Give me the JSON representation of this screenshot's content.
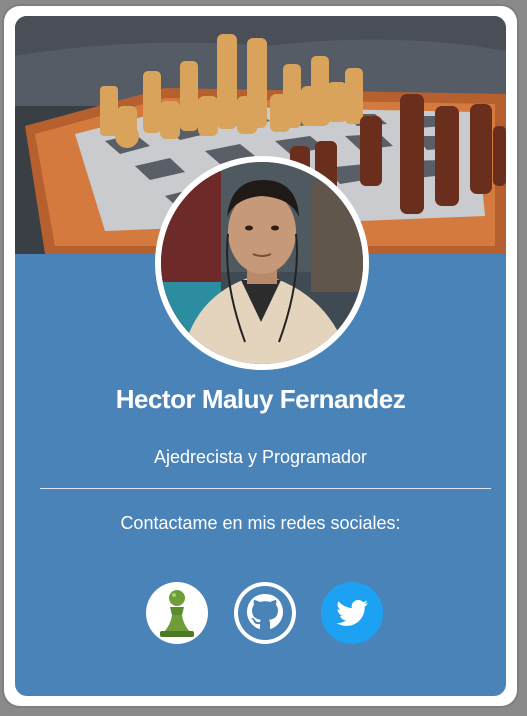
{
  "profile": {
    "name": "Hector Maluy Fernandez",
    "role": "Ajedrecista y Programador",
    "contact_text": "Contactame en mis redes sociales:"
  },
  "social": [
    {
      "icon": "chess-pawn-icon",
      "color": "#5d8b2f"
    },
    {
      "icon": "github-icon",
      "color": "#4a83b8"
    },
    {
      "icon": "twitter-icon",
      "color": "#1da1f2"
    }
  ],
  "colors": {
    "card_background": "#4a83b8",
    "card_border": "#ffffff",
    "page_background": "#8a8a8a"
  }
}
